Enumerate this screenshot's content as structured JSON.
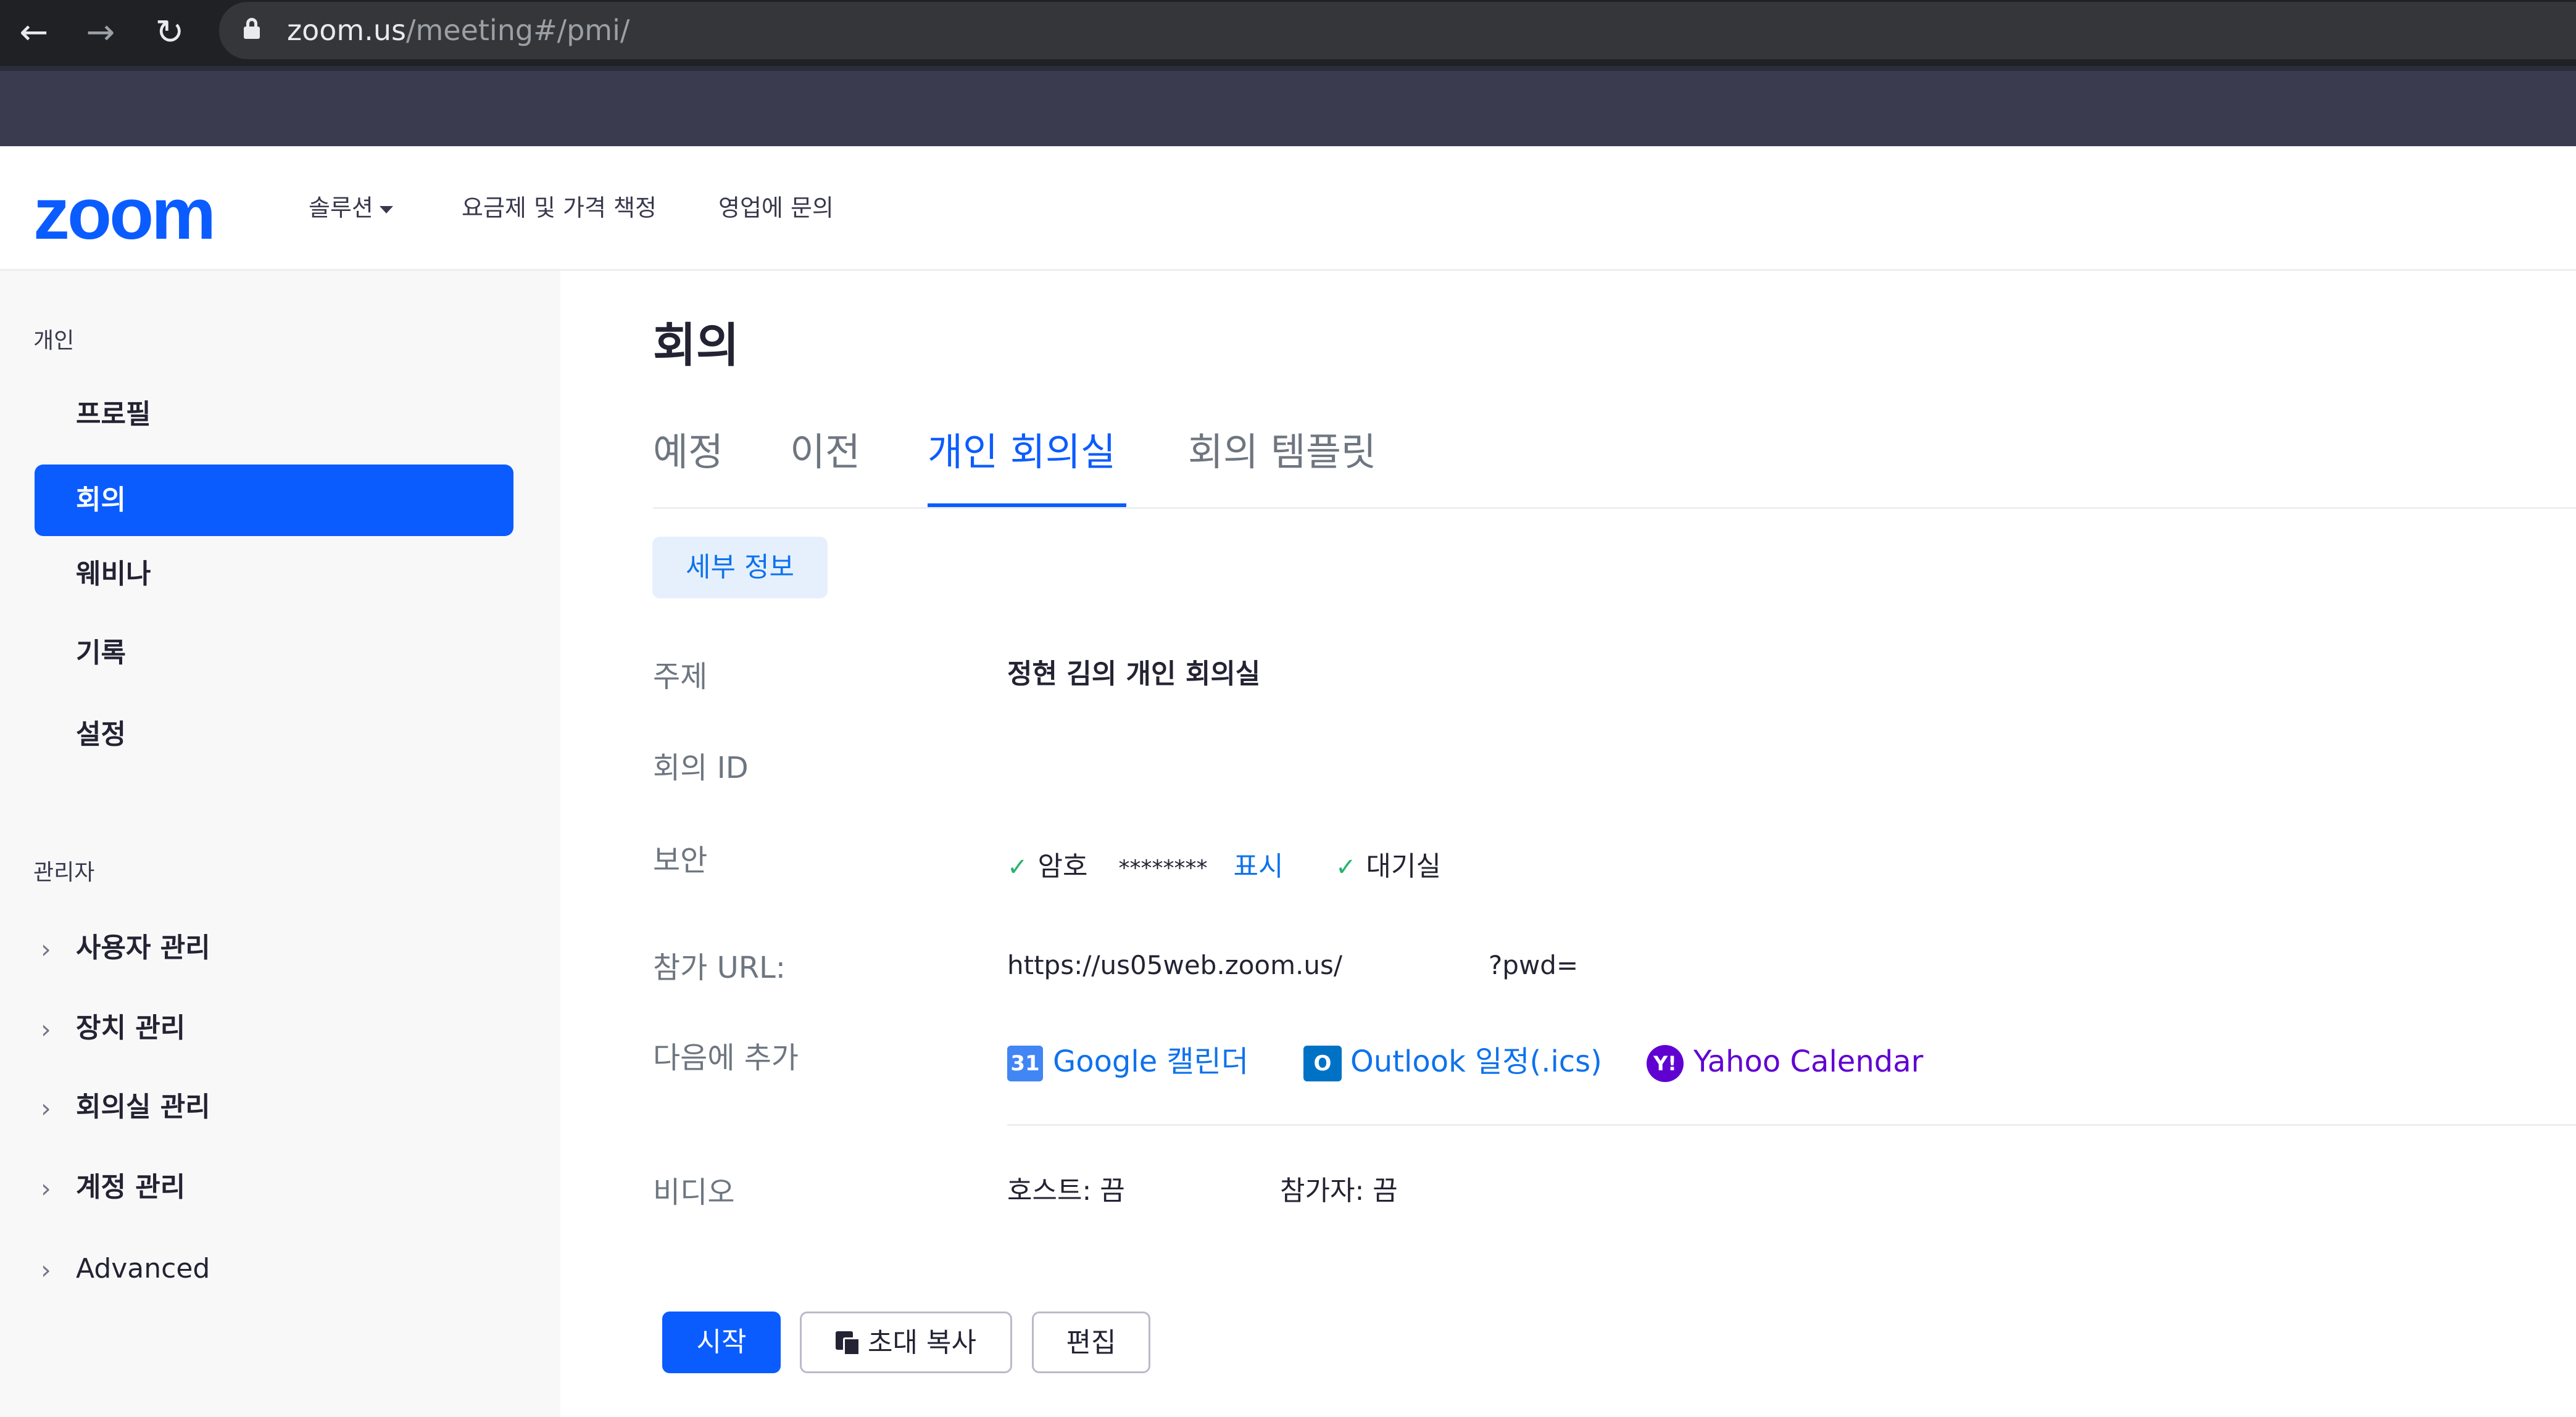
{
  "browser": {
    "url_host": "zoom.us",
    "url_path": "/meeting#/pmi/"
  },
  "header": {
    "logo": "zoom",
    "nav": [
      {
        "label": "솔루션"
      },
      {
        "label": "요금제 및 가격 책정"
      },
      {
        "label": "영업에 문의"
      }
    ]
  },
  "sidebar": {
    "personal_section": "개인",
    "personal_items": [
      {
        "label": "프로필"
      },
      {
        "label": "회의"
      },
      {
        "label": "웨비나"
      },
      {
        "label": "기록"
      },
      {
        "label": "설정"
      }
    ],
    "admin_section": "관리자",
    "admin_items": [
      {
        "label": "사용자 관리"
      },
      {
        "label": "장치 관리"
      },
      {
        "label": "회의실 관리"
      },
      {
        "label": "계정 관리"
      },
      {
        "label": "Advanced"
      }
    ]
  },
  "main": {
    "title": "회의",
    "tabs": [
      {
        "label": "예정"
      },
      {
        "label": "이전"
      },
      {
        "label": "개인 회의실"
      },
      {
        "label": "회의 템플릿"
      }
    ],
    "details_pill": "세부 정보",
    "rows": {
      "topic_label": "주제",
      "topic_value": "정현 김의 개인 회의실",
      "meeting_id_label": "회의 ID",
      "security_label": "보안",
      "passcode_label": "암호",
      "passcode_mask": "********",
      "show_link": "표시",
      "waiting_room": "대기실",
      "join_url_label": "참가 URL:",
      "join_url_prefix": "https://us05web.zoom.us/",
      "join_url_suffix": "?pwd=",
      "add_to_label": "다음에 추가",
      "google_calendar": "Google 캘린더",
      "google_icon_text": "31",
      "outlook_calendar": "Outlook 일정(.ics)",
      "outlook_icon_text": "O",
      "yahoo_calendar": "Yahoo Calendar",
      "yahoo_icon_text": "Y!",
      "video_label": "비디오",
      "host_video": "호스트: 끔",
      "participant_video": "참가자: 끔"
    },
    "buttons": {
      "start": "시작",
      "copy_invitation": "초대 복사",
      "edit": "편집"
    }
  },
  "colors": {
    "brand_blue": "#0b5cff",
    "link_blue": "#0e72ed",
    "check_green": "#25b46e",
    "yahoo_purple": "#6001d2"
  }
}
